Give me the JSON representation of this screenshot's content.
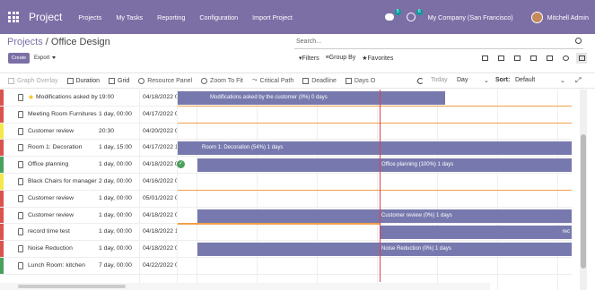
{
  "topbar": {
    "brand": "Project",
    "menu": [
      "Projects",
      "My Tasks",
      "Reporting",
      "Configuration",
      "Import Project"
    ],
    "messages_badge": "5",
    "activity_badge": "6",
    "company": "My Company (San Francisco)",
    "user": "Mitchell Admin",
    "color": "#7c6fa6"
  },
  "breadcrumb": {
    "parent": "Projects",
    "separator": " / ",
    "current": "Office Design"
  },
  "search": {
    "placeholder": "Search..."
  },
  "actions": {
    "create": "Create",
    "export": "Export"
  },
  "filters": {
    "filters": "Filters",
    "group_by": "Group By",
    "favorites": "Favorites"
  },
  "gantt_toolbar": {
    "graph_overlay": "Graph Overlay",
    "duration": "Duration",
    "grid": "Grid",
    "resource_panel": "Resource Panel",
    "zoom_to_fit": "Zoom To Fit",
    "critical_path": "Critical Path",
    "deadline": "Deadline",
    "days_off": "Days O",
    "today": "Today",
    "scale": "Day",
    "sort_label": "Sort:",
    "sort_value": "Default"
  },
  "rows": [
    {
      "name": "Modifications asked by the customer",
      "duration": "19:00",
      "date": "04/18/2022 0",
      "color": "#d9534f",
      "starred": true
    },
    {
      "name": "Meeting Room Furnitures",
      "duration": "1 day, 00:00",
      "date": "04/17/2022 0",
      "color": "#d9534f"
    },
    {
      "name": "Customer review",
      "duration": "20:30",
      "date": "04/20/2022 0",
      "color": "#f3e94c"
    },
    {
      "name": "Room 1: Decoration",
      "duration": "1 day, 15:00",
      "date": "04/17/2022 1",
      "color": "#d9534f"
    },
    {
      "name": "Office planning",
      "duration": "1 day, 00:00",
      "date": "04/18/2022 0",
      "color": "#49a05c"
    },
    {
      "name": "Black Chairs for manager",
      "duration": "2 day, 00:00",
      "date": "04/16/2022 0",
      "color": "#f3e94c"
    },
    {
      "name": "Customer review",
      "duration": "1 day, 00:00",
      "date": "05/01/2022 0",
      "color": "#d9534f"
    },
    {
      "name": "Customer review",
      "duration": "1 day, 00:00",
      "date": "04/18/2022 0",
      "color": "#d9534f"
    },
    {
      "name": "record time test",
      "duration": "1 day, 00:00",
      "date": "04/18/2022 1",
      "color": "#d9534f"
    },
    {
      "name": "Noise Reduction",
      "duration": "1 day, 00:00",
      "date": "04/18/2022 0",
      "color": "#d9534f"
    },
    {
      "name": "Lunch Room: kitchen",
      "duration": "7 day, 00:00",
      "date": "04/22/2022 0",
      "color": "#49a05c"
    }
  ],
  "bars": {
    "b0": "Modifications asked by the customer (0%) 0 days",
    "b3": "Room 1: Decoration (54%) 1 days",
    "b4": "Office planning (100%) 1 days",
    "b7": "Customer review (0%) 1 days",
    "b8": "rec",
    "b9": "Noise Reduction (0%) 1 days"
  }
}
